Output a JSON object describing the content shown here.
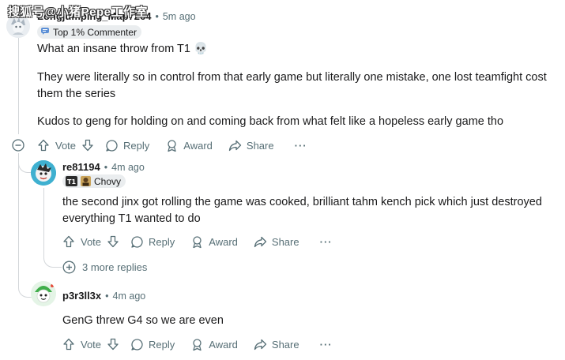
{
  "watermark": "搜狐号@小猪Pepe工作室",
  "comments": [
    {
      "username": "Longjumping_Map7264",
      "time": "5m ago",
      "flair": "Top 1% Commenter",
      "paragraphs": [
        "What an insane throw from T1 💀",
        "They were literally so in control from that early game but literally one mistake, one lost teamfight cost them the series",
        "Kudos to geng for holding on and coming back from what felt like a hopeless early game tho"
      ]
    },
    {
      "username": "re81194",
      "time": "4m ago",
      "flair": "Chovy",
      "flair_badge": "T1",
      "paragraphs": [
        "the second jinx got rolling the game was cooked, brilliant tahm kench pick which just destroyed everything T1 wanted to do"
      ]
    },
    {
      "username": "p3r3ll3x",
      "time": "4m ago",
      "paragraphs": [
        "GenG threw G4 so we are even"
      ]
    }
  ],
  "actions": {
    "vote": "Vote",
    "reply": "Reply",
    "award": "Award",
    "share": "Share",
    "more": "···"
  },
  "more_replies": "3 more replies",
  "separator": "•",
  "colors": {
    "text": "#1a1a1b",
    "muted": "#576f76",
    "thread_line": "#d3d6da",
    "flair_bg": "#eaedef"
  }
}
